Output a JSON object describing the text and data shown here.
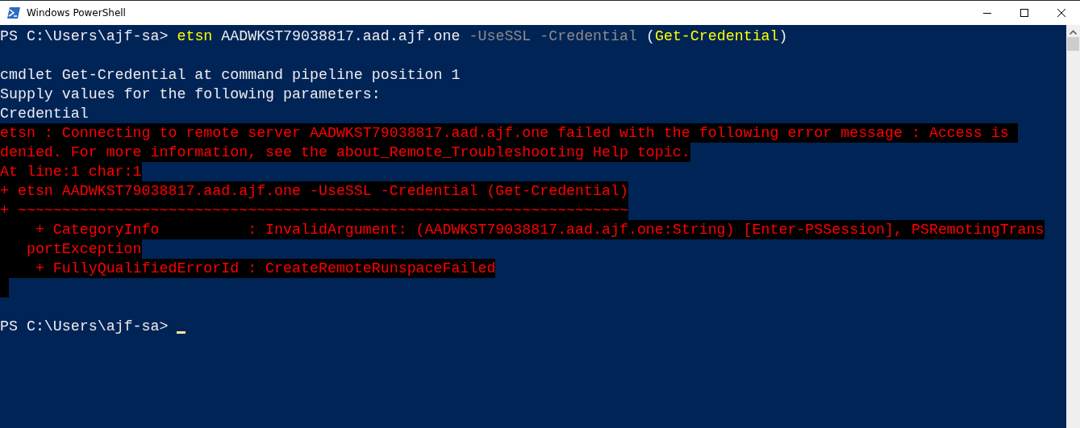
{
  "window": {
    "title": "Windows PowerShell"
  },
  "console": {
    "lines": [
      {
        "kind": "input",
        "segments": [
          {
            "kind": "prompt",
            "text": "PS C:\\Users\\ajf-sa>"
          },
          {
            "kind": "command",
            "text": "etsn"
          },
          {
            "kind": "plain",
            "text": "AADWKST79038817.aad.ajf.one"
          },
          {
            "kind": "parameter",
            "text": "-UseSSL"
          },
          {
            "kind": "parameter",
            "text": "-Credential"
          },
          {
            "kind": "plain",
            "text": "("
          },
          {
            "kind": "command",
            "text": "Get-Credential"
          },
          {
            "kind": "plain",
            "text": ")"
          }
        ]
      },
      {
        "kind": "blank"
      },
      {
        "kind": "output",
        "text": "cmdlet Get-Credential at command pipeline position 1"
      },
      {
        "kind": "output",
        "text": "Supply values for the following parameters:"
      },
      {
        "kind": "output",
        "text": "Credential"
      },
      {
        "kind": "error",
        "text": "etsn : Connecting to remote server AADWKST79038817.aad.ajf.one failed with the following error message : Access is "
      },
      {
        "kind": "error",
        "text": "denied. For more information, see the about_Remote_Troubleshooting Help topic."
      },
      {
        "kind": "error",
        "text": "At line:1 char:1"
      },
      {
        "kind": "error",
        "text": "+ etsn AADWKST79038817.aad.ajf.one -UseSSL -Credential (Get-Credential)"
      },
      {
        "kind": "error",
        "text": "+ ~~~~~~~~~~~~~~~~~~~~~~~~~~~~~~~~~~~~~~~~~~~~~~~~~~~~~~~~~~~~~~~~~~~~~"
      },
      {
        "kind": "error",
        "text": "    + CategoryInfo          : InvalidArgument: (AADWKST79038817.aad.ajf.one:String) [Enter-PSSession], PSRemotingTrans"
      },
      {
        "kind": "error",
        "text": "   portException"
      },
      {
        "kind": "error",
        "text": "    + FullyQualifiedErrorId : CreateRemoteRunspaceFailed"
      },
      {
        "kind": "error-fill"
      },
      {
        "kind": "blank"
      },
      {
        "kind": "prompt",
        "text": "PS C:\\Users\\ajf-sa>"
      }
    ]
  }
}
